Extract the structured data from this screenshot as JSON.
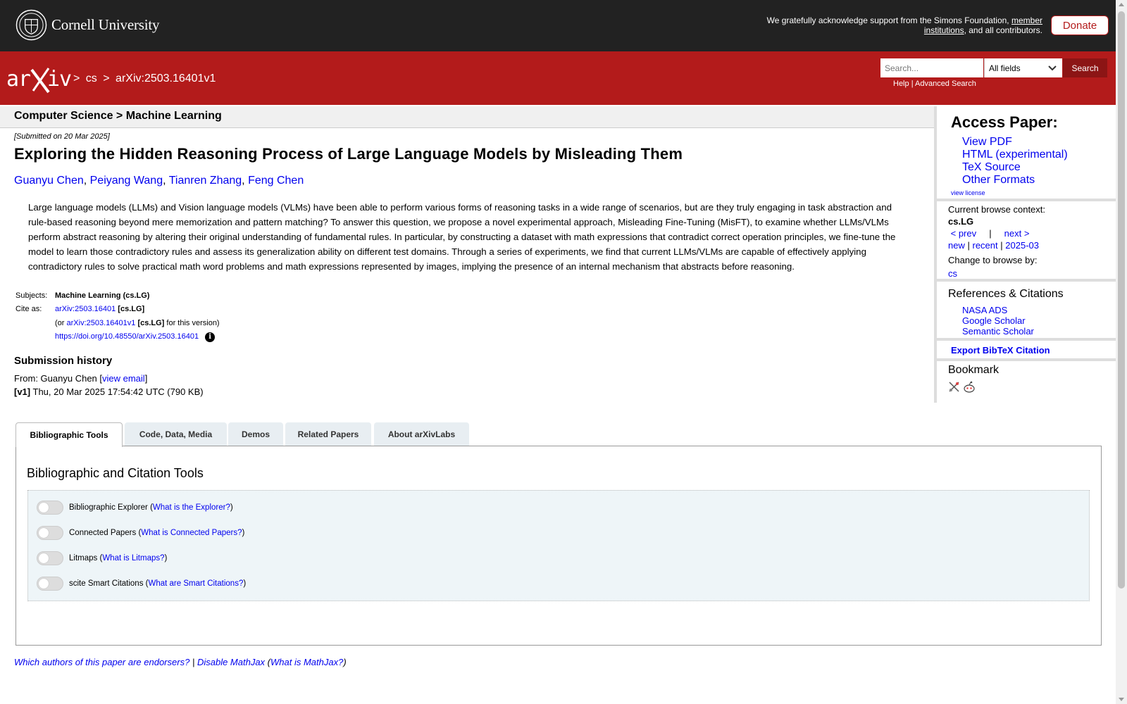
{
  "header": {
    "institution": "Cornell University",
    "support_prefix": "We gratefully acknowledge support from the Simons Foundation,",
    "support_link": "member institutions",
    "support_suffix": ", and all contributors.",
    "donate_label": "Donate"
  },
  "nav": {
    "logo_text": "arXiv",
    "crumb_sep1": ">",
    "crumb_cs": "cs",
    "crumb_sep2": ">",
    "crumb_id": "arXiv:2503.16401v1",
    "search_placeholder": "Search...",
    "search_field": "All fields",
    "search_button": "Search",
    "help": "Help",
    "sep": "|",
    "advanced": "Advanced Search"
  },
  "paper": {
    "subject_header": "Computer Science > Machine Learning",
    "submitted": "[Submitted on 20 Mar 2025]",
    "title": "Exploring the Hidden Reasoning Process of Large Language Models by Misleading Them",
    "authors": [
      "Guanyu Chen",
      "Peiyang Wang",
      "Tianren Zhang",
      "Feng Chen"
    ],
    "abstract": "Large language models (LLMs) and Vision language models (VLMs) have been able to perform various forms of reasoning tasks in a wide range of scenarios, but are they truly engaging in task abstraction and rule-based reasoning beyond mere memorization and pattern matching? To answer this question, we propose a novel experimental approach, Misleading Fine-Tuning (MisFT), to examine whether LLMs/VLMs perform abstract reasoning by altering their original understanding of fundamental rules. In particular, by constructing a dataset with math expressions that contradict correct operation principles, we fine-tune the model to learn those contradictory rules and assess its generalization ability on different test domains. Through a series of experiments, we find that current LLMs/VLMs are capable of effectively applying contradictory rules to solve practical math word problems and math expressions represented by images, implying the presence of an internal mechanism that abstracts before reasoning.",
    "subjects_label": "Subjects:",
    "subjects_value": "Machine Learning (cs.LG)",
    "cite_label": "Cite as:",
    "cite_id": "arXiv:2503.16401",
    "cite_tag": "[cs.LG]",
    "cite_or": "(or",
    "cite_version_id": "arXiv:2503.16401v1",
    "cite_version_tag": "[cs.LG]",
    "cite_version_suffix": "for this version)",
    "doi": "https://doi.org/10.48550/arXiv.2503.16401",
    "info_glyph": "i"
  },
  "history": {
    "title": "Submission history",
    "from_prefix": "From: Guanyu Chen [",
    "view_email": "view email",
    "from_suffix": "]",
    "v1_label": "[v1]",
    "v1_text": "Thu, 20 Mar 2025 17:54:42 UTC (790 KB)"
  },
  "sidebar": {
    "access_title": "Access Paper:",
    "access_links": [
      "View PDF",
      "HTML (experimental)",
      "TeX Source",
      "Other Formats"
    ],
    "view_license": "view license",
    "browse_context_label": "Current browse context:",
    "browse_context": "cs.LG",
    "prev": "< prev",
    "pipe": "|",
    "next": "next >",
    "new": "new",
    "recent": "recent",
    "month": "2025-03",
    "change_label": "Change to browse by:",
    "change_cs": "cs",
    "refs_title": "References & Citations",
    "refs_links": [
      "NASA ADS",
      "Google Scholar",
      "Semantic Scholar"
    ],
    "export": "Export BibTeX Citation",
    "bookmark": "Bookmark"
  },
  "tabs": [
    "Bibliographic Tools",
    "Code, Data, Media",
    "Demos",
    "Related Papers",
    "About arXivLabs"
  ],
  "tools": {
    "title": "Bibliographic and Citation Tools",
    "items": [
      {
        "label": "Bibliographic Explorer",
        "help": "What is the Explorer?"
      },
      {
        "label": "Connected Papers",
        "help": "What is Connected Papers?"
      },
      {
        "label": "Litmaps",
        "help": "What is Litmaps?"
      },
      {
        "label": "scite Smart Citations",
        "help": "What are Smart Citations?"
      }
    ]
  },
  "footer": {
    "endorsers": "Which authors of this paper are endorsers?",
    "sep": "|",
    "disable_mathjax": "Disable MathJax",
    "what_mathjax": "What is MathJax?"
  },
  "colors": {
    "arxiv_red": "#b31b1b",
    "top_bar": "#222222",
    "link": "#0000ee"
  }
}
